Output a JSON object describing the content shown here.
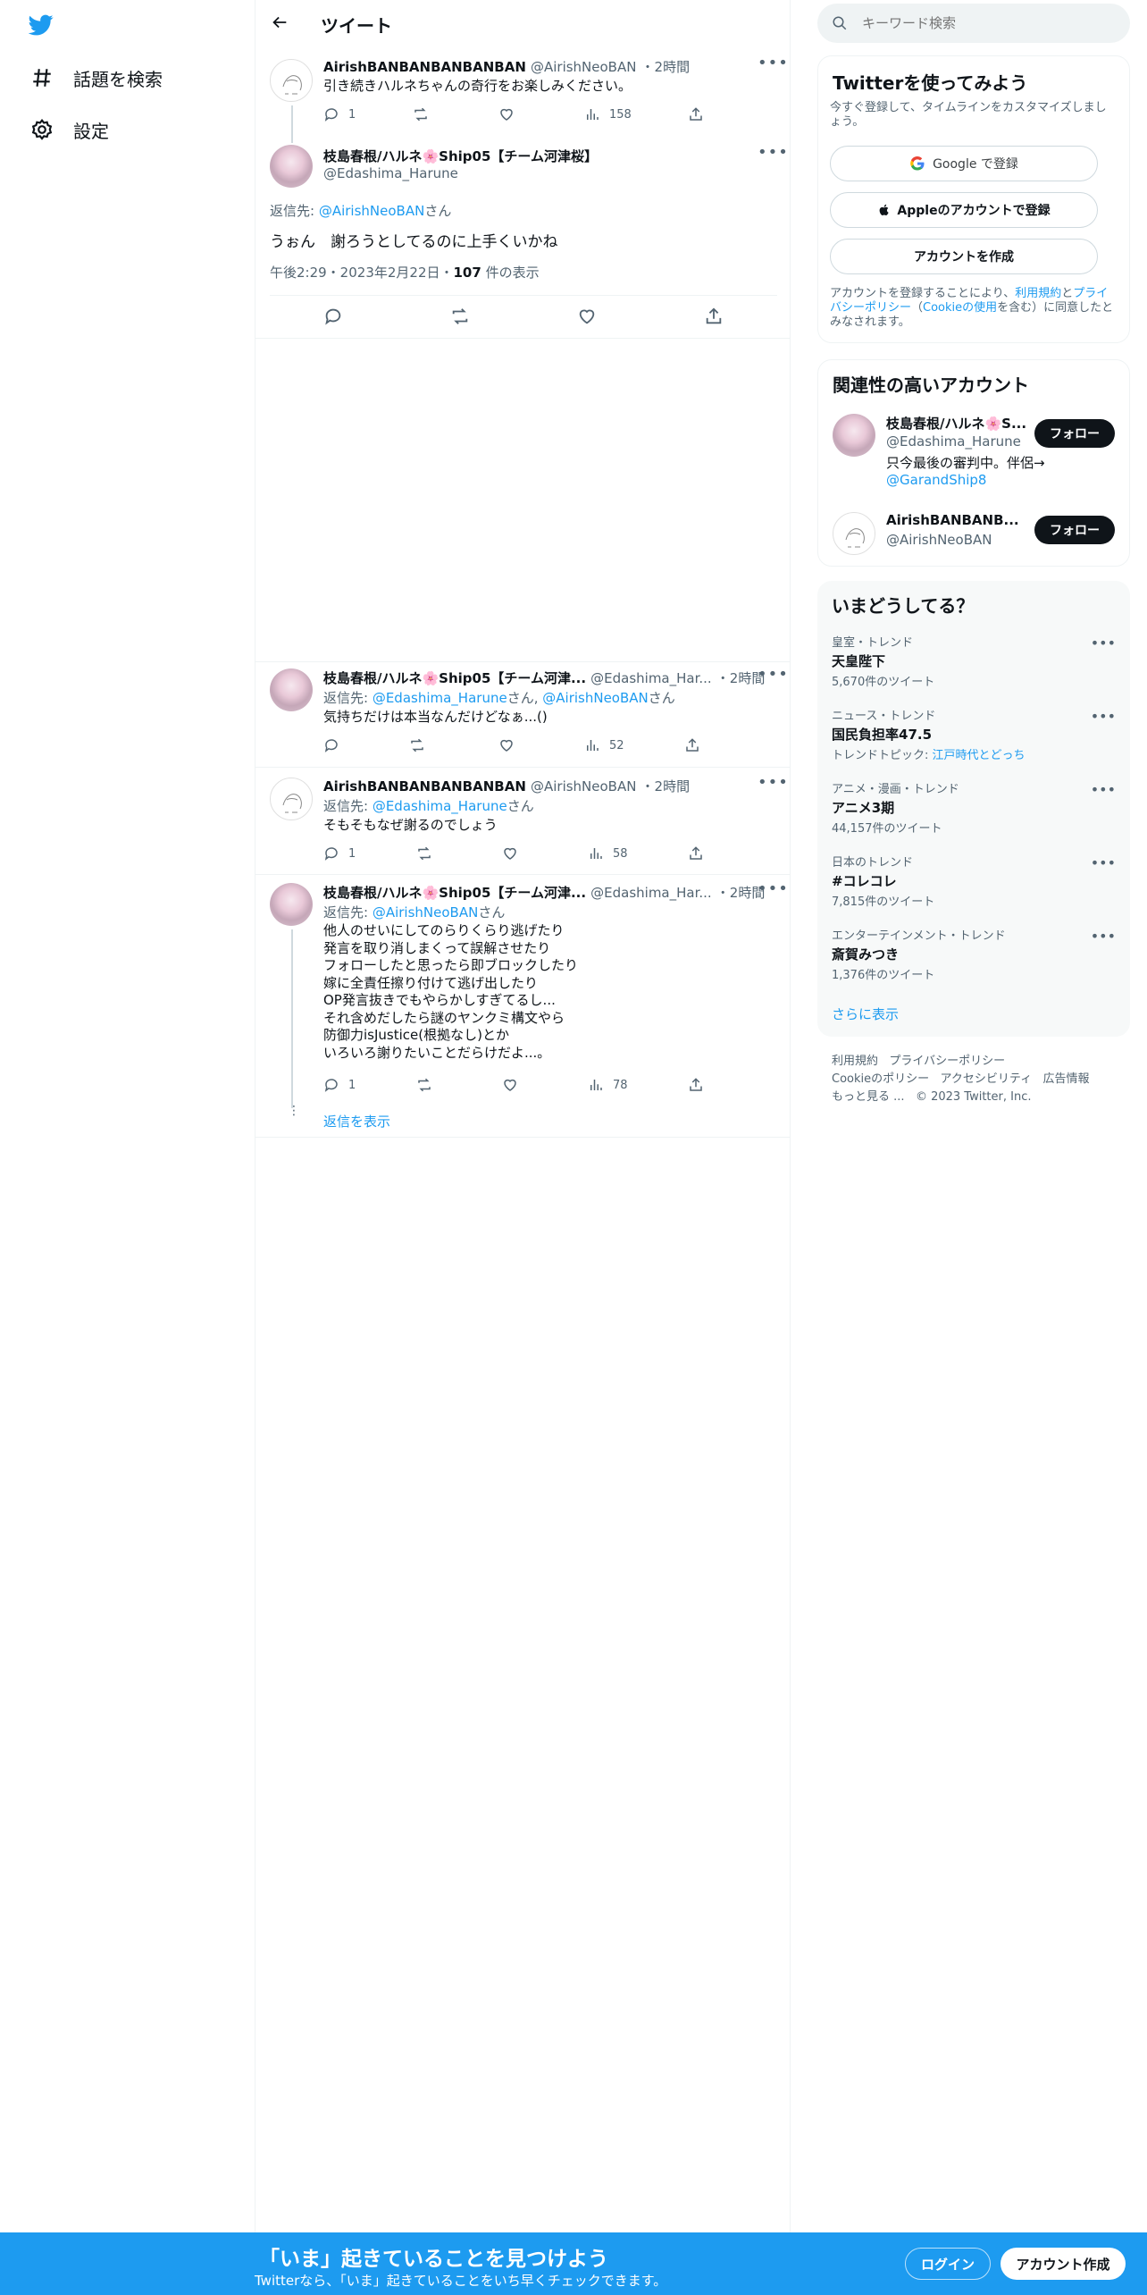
{
  "nav": {
    "explore_label": "話題を検索",
    "settings_label": "設定"
  },
  "header": {
    "title": "ツイート"
  },
  "tweets": {
    "t1": {
      "name": "AirishBANBANBANBANBAN",
      "handle": "@AirishNeoBAN",
      "time": "・2時間",
      "text": "引き続きハルネちゃんの奇行をお楽しみください。",
      "replies": "1",
      "views": "158"
    },
    "main": {
      "name": "枝島春根/ハルネ🌸Ship05【チーム河津桜】",
      "handle": "@Edashima_Harune",
      "reply_prefix": "返信先: ",
      "reply_to": "@AirishNeoBAN",
      "reply_suffix": "さん",
      "text": "うぉん　謝ろうとしてるのに上手くいかね",
      "timestamp": "午後2:29・2023年2月22日・",
      "views_count": "107",
      "views_label": " 件の表示"
    },
    "t3": {
      "name": "枝島春根/ハルネ🌸Ship05【チーム河津...",
      "handle": "@Edashima_Har...",
      "time": "・2時間",
      "reply_prefix": "返信先: ",
      "reply_to_1": "@Edashima_Harune",
      "reply_mid": "さん,",
      "reply_to_2": "@AirishNeoBAN",
      "reply_suffix": "さん",
      "text": "気持ちだけは本当なんだけどなぁ...()",
      "views": "52"
    },
    "t4": {
      "name": "AirishBANBANBANBANBAN",
      "handle": "@AirishNeoBAN",
      "time": "・2時間",
      "reply_prefix": "返信先: ",
      "reply_to": "@Edashima_Harune",
      "reply_suffix": "さん",
      "text": "そもそもなぜ謝るのでしょう",
      "replies": "1",
      "views": "58"
    },
    "t5": {
      "name": "枝島春根/ハルネ🌸Ship05【チーム河津...",
      "handle": "@Edashima_Har...",
      "time": "・2時間",
      "reply_prefix": "返信先: ",
      "reply_to": "@AirishNeoBAN",
      "reply_suffix": "さん",
      "lines": [
        "他人のせいにしてのらりくらり逃げたり",
        "発言を取り消しまくって誤解させたり",
        "フォローしたと思ったら即ブロックしたり",
        "嫁に全責任擦り付けて逃げ出したり",
        "OP発言抜きでもやらかしすぎてるし...",
        "それ含めだしたら謎のヤンクミ構文やら",
        "防御力isJustice(根拠なし)とか",
        "いろいろ謝りたいことだらけだよ...。"
      ],
      "replies": "1",
      "views": "78"
    },
    "show_replies": "返信を表示"
  },
  "search": {
    "placeholder": "キーワード検索"
  },
  "signup": {
    "title": "Twitterを使ってみよう",
    "desc": "今すぐ登録して、タイムラインをカスタマイズしましょう。",
    "google": "Google で登録",
    "apple": "Appleのアカウントで登録",
    "create": "アカウントを作成",
    "legal_1": "アカウントを登録することにより、",
    "terms": "利用規約",
    "legal_and": "と",
    "privacy": "プライバシーポリシー",
    "legal_paren_open": "（",
    "cookie": "Cookieの使用",
    "legal_2": "を含む）に同意したとみなされます。"
  },
  "related": {
    "title": "関連性の高いアカウント",
    "accounts": [
      {
        "name": "枝島春根/ハルネ🌸S...",
        "handle": "@Edashima_Harune",
        "bio": "只今最後の審判中。伴侶→",
        "bio_link": "@GarandShip8",
        "follow": "フォロー"
      },
      {
        "name": "AirishBANBANB...",
        "handle": "@AirishNeoBAN",
        "follow": "フォロー"
      }
    ]
  },
  "trends": {
    "title": "いまどうしてる？",
    "items": [
      {
        "category": "皇室・トレンド",
        "title": "天皇陛下",
        "count": "5,670件のツイート"
      },
      {
        "category": "ニュース・トレンド",
        "title": "国民負担率47.5",
        "topic_prefix": "トレンドトピック: ",
        "topic": "江戸時代とどっち"
      },
      {
        "category": "アニメ・漫画・トレンド",
        "title": "アニメ3期",
        "count": "44,157件のツイート"
      },
      {
        "category": "日本のトレンド",
        "title": "#コレコレ",
        "count": "7,815件のツイート"
      },
      {
        "category": "エンターテインメント・トレンド",
        "title": "斎賀みつき",
        "count": "1,376件のツイート"
      }
    ],
    "show_more": "さらに表示"
  },
  "footer": {
    "terms": "利用規約",
    "privacy": "プライバシーポリシー",
    "cookie": "Cookieのポリシー",
    "accessibility": "アクセシビリティ",
    "ads": "広告情報",
    "more": "もっと見る ...",
    "copyright": "© 2023 Twitter, Inc."
  },
  "bottom": {
    "headline": "「いま」起きていることを見つけよう",
    "sub": "Twitterなら、「いま」起きていることをいち早くチェックできます。",
    "login": "ログイン",
    "signup": "アカウント作成"
  },
  "colors": {
    "brand": "#1d9bf0",
    "text": "#0f1419",
    "secondary": "#536471"
  }
}
